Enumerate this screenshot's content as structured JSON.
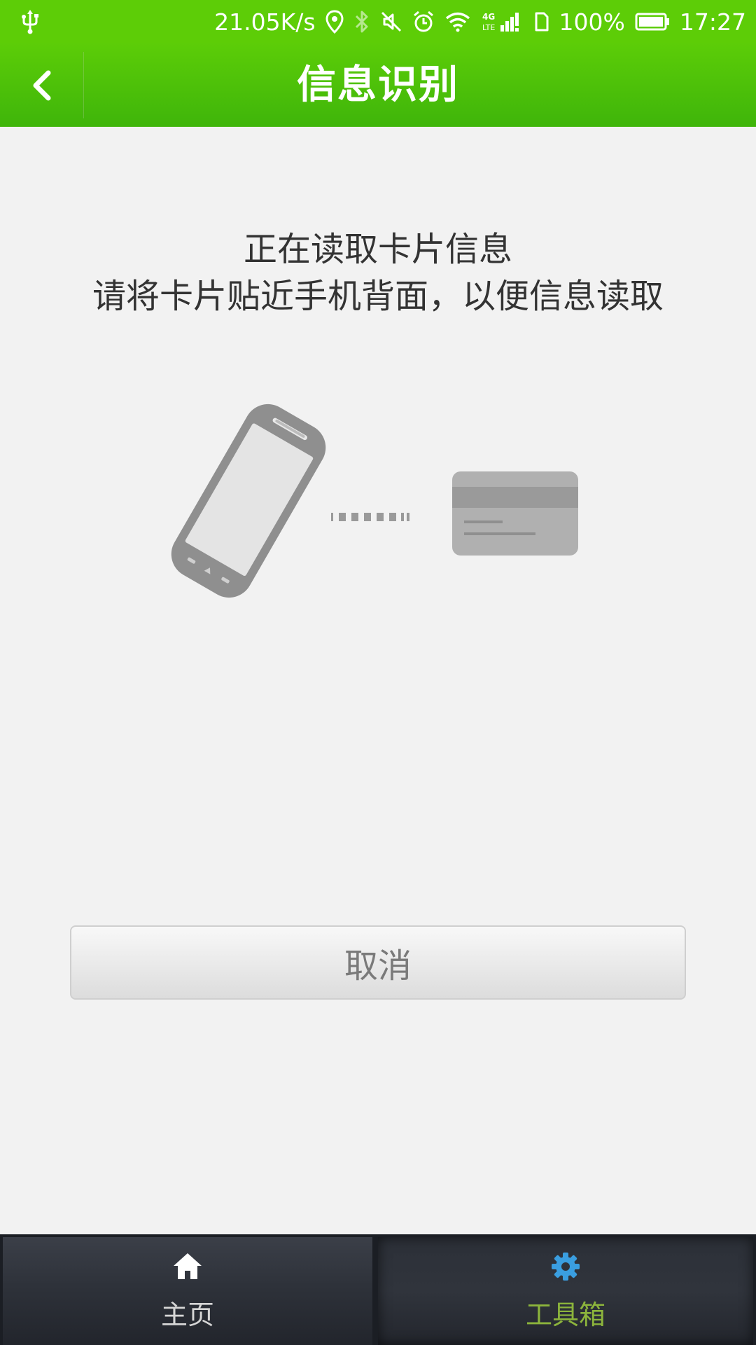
{
  "status_bar": {
    "network_speed": "21.05K/s",
    "network_type": "4G LTE",
    "battery_percent": "100%",
    "time": "17:27",
    "battery_level": 1.0,
    "icons": [
      "usb-icon",
      "location-icon",
      "bluetooth-icon",
      "mute-icon",
      "alarm-icon",
      "wifi-icon",
      "signal-icon",
      "sim-icon",
      "battery-icon"
    ]
  },
  "header": {
    "title": "信息识别",
    "back_icon": "chevron-left-icon"
  },
  "content": {
    "line1": "正在读取卡片信息",
    "line2": "请将卡片贴近手机背面，以便信息读取",
    "illustration_icons": [
      "phone-illustration",
      "card-illustration"
    ]
  },
  "cancel_button": {
    "label": "取消"
  },
  "tab_bar": {
    "tabs": [
      {
        "label": "主页",
        "icon": "home-icon",
        "selected": false
      },
      {
        "label": "工具箱",
        "icon": "gear-icon",
        "selected": true
      }
    ]
  },
  "colors": {
    "header_green": "#4cc00a",
    "background": "#f2f2f2",
    "tab_bar": "#2e323a",
    "selected_tab_text": "#8cb43c",
    "gear_blue": "#3a9ee0"
  }
}
